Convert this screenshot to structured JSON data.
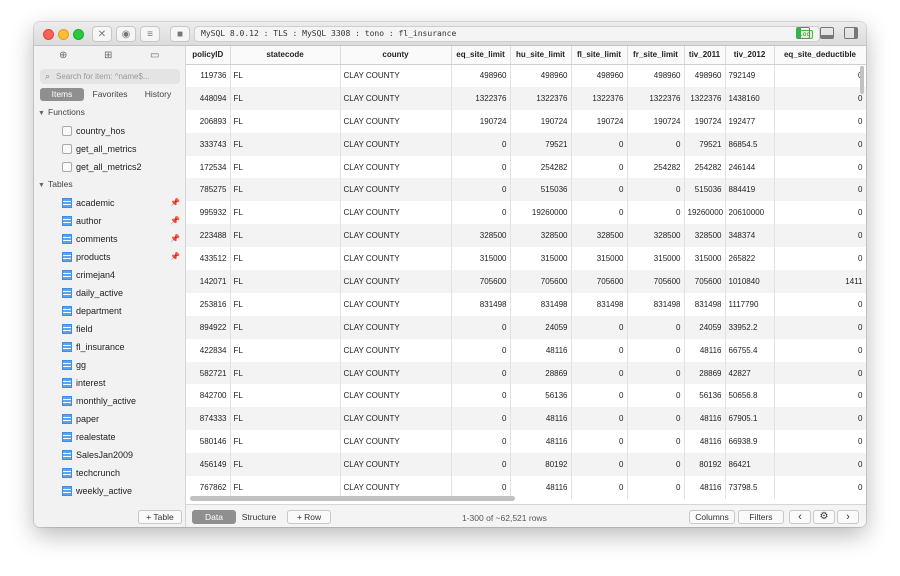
{
  "titlebar": {
    "connection": "MySQL 8.0.12 : TLS : MySQL 3308 : tono : fl_insurance",
    "badge": "loc"
  },
  "sidebar": {
    "search_placeholder": "Search for item: ^name$...",
    "tabs": [
      "Items",
      "Favorites",
      "History"
    ],
    "functions_header": "Functions",
    "functions": [
      "country_hos",
      "get_all_metrics",
      "get_all_metrics2"
    ],
    "tables_header": "Tables",
    "tables": [
      {
        "name": "academic",
        "pinned": true
      },
      {
        "name": "author",
        "pinned": true
      },
      {
        "name": "comments",
        "pinned": true
      },
      {
        "name": "products",
        "pinned": true
      },
      {
        "name": "crimejan4",
        "pinned": false
      },
      {
        "name": "daily_active",
        "pinned": false
      },
      {
        "name": "department",
        "pinned": false
      },
      {
        "name": "field",
        "pinned": false
      },
      {
        "name": "fl_insurance",
        "pinned": false
      },
      {
        "name": "gg",
        "pinned": false
      },
      {
        "name": "interest",
        "pinned": false
      },
      {
        "name": "monthly_active",
        "pinned": false
      },
      {
        "name": "paper",
        "pinned": false
      },
      {
        "name": "realestate",
        "pinned": false
      },
      {
        "name": "SalesJan2009",
        "pinned": false
      },
      {
        "name": "techcrunch",
        "pinned": false
      },
      {
        "name": "weekly_active",
        "pinned": false
      }
    ],
    "add_table_label": "+ Table"
  },
  "grid": {
    "columns": [
      "policyID",
      "statecode",
      "county",
      "eq_site_limit",
      "hu_site_limit",
      "fl_site_limit",
      "fr_site_limit",
      "tiv_2011",
      "tiv_2012",
      "eq_site_deductible"
    ],
    "rows": [
      [
        "119736",
        "FL",
        "CLAY COUNTY",
        "498960",
        "498960",
        "498960",
        "498960",
        "498960",
        "792149",
        "0"
      ],
      [
        "448094",
        "FL",
        "CLAY COUNTY",
        "1322376",
        "1322376",
        "1322376",
        "1322376",
        "1322376",
        "1438160",
        "0"
      ],
      [
        "206893",
        "FL",
        "CLAY COUNTY",
        "190724",
        "190724",
        "190724",
        "190724",
        "190724",
        "192477",
        "0"
      ],
      [
        "333743",
        "FL",
        "CLAY COUNTY",
        "0",
        "79521",
        "0",
        "0",
        "79521",
        "86854.5",
        "0"
      ],
      [
        "172534",
        "FL",
        "CLAY COUNTY",
        "0",
        "254282",
        "0",
        "254282",
        "254282",
        "246144",
        "0"
      ],
      [
        "785275",
        "FL",
        "CLAY COUNTY",
        "0",
        "515036",
        "0",
        "0",
        "515036",
        "884419",
        "0"
      ],
      [
        "995932",
        "FL",
        "CLAY COUNTY",
        "0",
        "19260000",
        "0",
        "0",
        "19260000",
        "20610000",
        "0"
      ],
      [
        "223488",
        "FL",
        "CLAY COUNTY",
        "328500",
        "328500",
        "328500",
        "328500",
        "328500",
        "348374",
        "0"
      ],
      [
        "433512",
        "FL",
        "CLAY COUNTY",
        "315000",
        "315000",
        "315000",
        "315000",
        "315000",
        "265822",
        "0"
      ],
      [
        "142071",
        "FL",
        "CLAY COUNTY",
        "705600",
        "705600",
        "705600",
        "705600",
        "705600",
        "1010840",
        "1411"
      ],
      [
        "253816",
        "FL",
        "CLAY COUNTY",
        "831498",
        "831498",
        "831498",
        "831498",
        "831498",
        "1117790",
        "0"
      ],
      [
        "894922",
        "FL",
        "CLAY COUNTY",
        "0",
        "24059",
        "0",
        "0",
        "24059",
        "33952.2",
        "0"
      ],
      [
        "422834",
        "FL",
        "CLAY COUNTY",
        "0",
        "48116",
        "0",
        "0",
        "48116",
        "66755.4",
        "0"
      ],
      [
        "582721",
        "FL",
        "CLAY COUNTY",
        "0",
        "28869",
        "0",
        "0",
        "28869",
        "42827",
        "0"
      ],
      [
        "842700",
        "FL",
        "CLAY COUNTY",
        "0",
        "56136",
        "0",
        "0",
        "56136",
        "50656.8",
        "0"
      ],
      [
        "874333",
        "FL",
        "CLAY COUNTY",
        "0",
        "48116",
        "0",
        "0",
        "48116",
        "67905.1",
        "0"
      ],
      [
        "580146",
        "FL",
        "CLAY COUNTY",
        "0",
        "48116",
        "0",
        "0",
        "48116",
        "66938.9",
        "0"
      ],
      [
        "456149",
        "FL",
        "CLAY COUNTY",
        "0",
        "80192",
        "0",
        "0",
        "80192",
        "86421",
        "0"
      ],
      [
        "767862",
        "FL",
        "CLAY COUNTY",
        "0",
        "48116",
        "0",
        "0",
        "48116",
        "73798.5",
        "0"
      ]
    ]
  },
  "footer": {
    "data_tab": "Data",
    "structure_tab": "Structure",
    "add_row": "+ Row",
    "row_count": "1-300 of ~62,521 rows",
    "columns_btn": "Columns",
    "filters_btn": "Filters",
    "prev": "‹",
    "settings": "⚙",
    "next": "›"
  }
}
